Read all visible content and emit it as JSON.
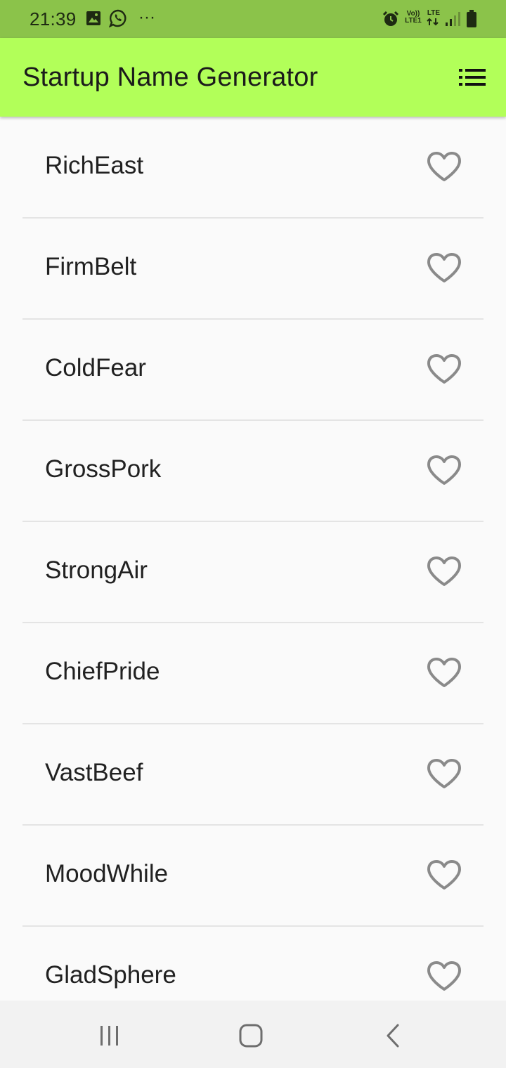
{
  "status_bar": {
    "time": "21:39",
    "more": "···",
    "volte_label": "Vo)) LTE1",
    "lte_label": "LTE",
    "icons": [
      "gallery-icon",
      "whatsapp-icon",
      "more-notifications-icon",
      "alarm-icon",
      "volte-icon",
      "lte-data-icon",
      "signal-icon",
      "battery-icon"
    ],
    "background": "#8bc34a"
  },
  "app_bar": {
    "title": "Startup Name Generator",
    "action_icon": "list-icon",
    "background": "#b2ff59"
  },
  "names": [
    {
      "label": "RichEast",
      "saved": false
    },
    {
      "label": "FirmBelt",
      "saved": false
    },
    {
      "label": "ColdFear",
      "saved": false
    },
    {
      "label": "GrossPork",
      "saved": false
    },
    {
      "label": "StrongAir",
      "saved": false
    },
    {
      "label": "ChiefPride",
      "saved": false
    },
    {
      "label": "VastBeef",
      "saved": false
    },
    {
      "label": "MoodWhile",
      "saved": false
    },
    {
      "label": "GladSphere",
      "saved": false
    }
  ],
  "nav_bar": {
    "buttons": [
      "recents-icon",
      "home-icon",
      "back-icon"
    ]
  },
  "colors": {
    "heart_outline": "#8a8a8a",
    "text": "#212121",
    "divider": "#e4e4e4"
  }
}
